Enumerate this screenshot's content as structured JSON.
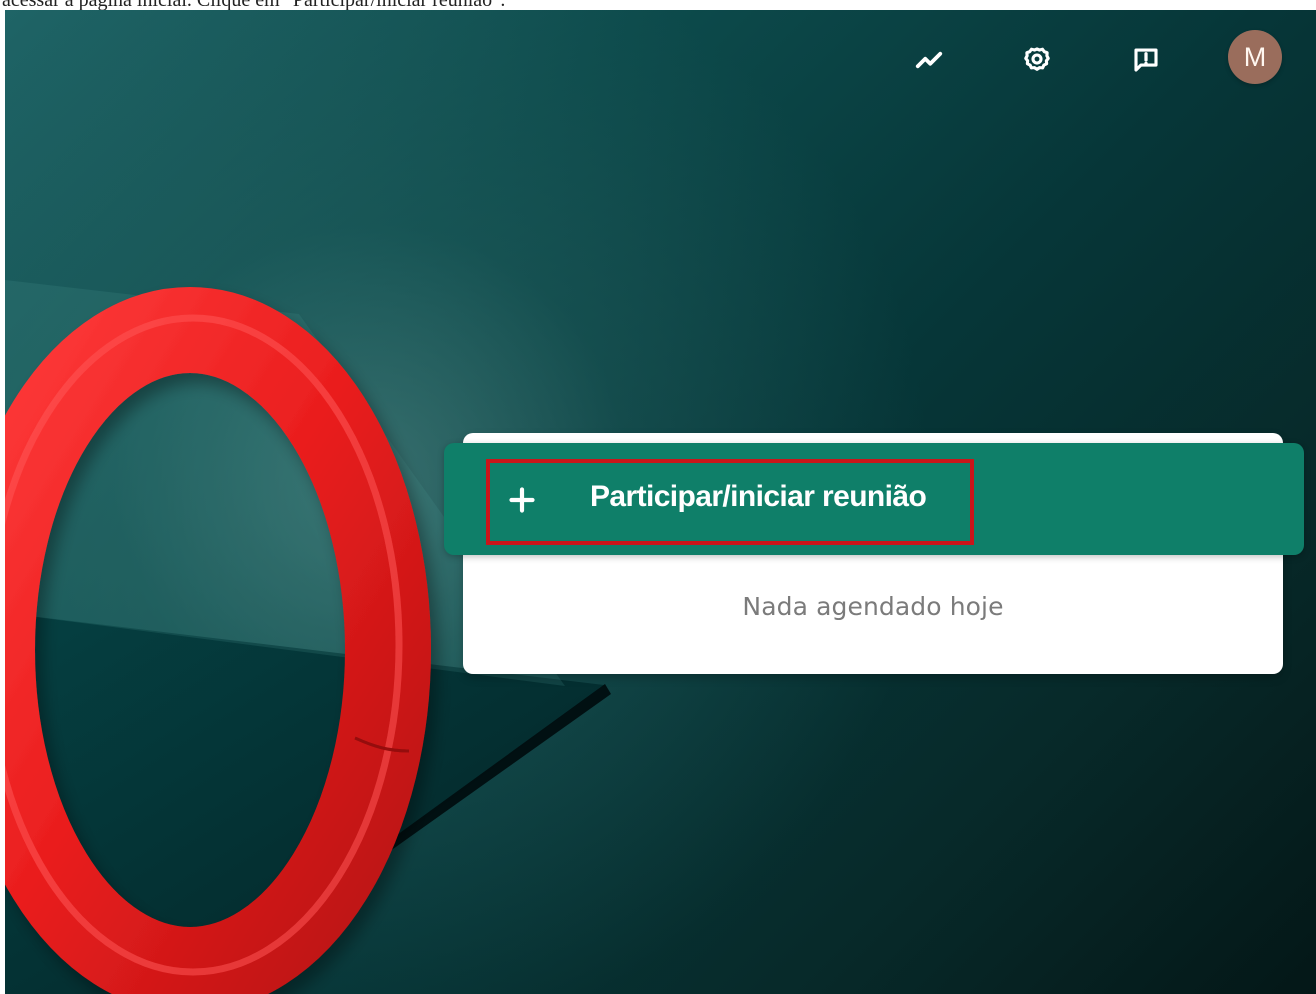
{
  "caption": {
    "text": "acessar a página inicial. Clique em \"Participar/iniciar reunião\"."
  },
  "header": {
    "icons": [
      {
        "name": "trend-icon"
      },
      {
        "name": "settings-icon"
      },
      {
        "name": "feedback-icon"
      }
    ],
    "avatar": {
      "initial": "M",
      "background_color": "#9a6d5c"
    }
  },
  "main": {
    "start_meeting_label": "Participar/iniciar reunião",
    "start_meeting_icon": "plus-icon",
    "empty_schedule_text": "Nada agendado hoje",
    "accent_color": "#0f7f69",
    "highlight_color": "#c9161a"
  }
}
